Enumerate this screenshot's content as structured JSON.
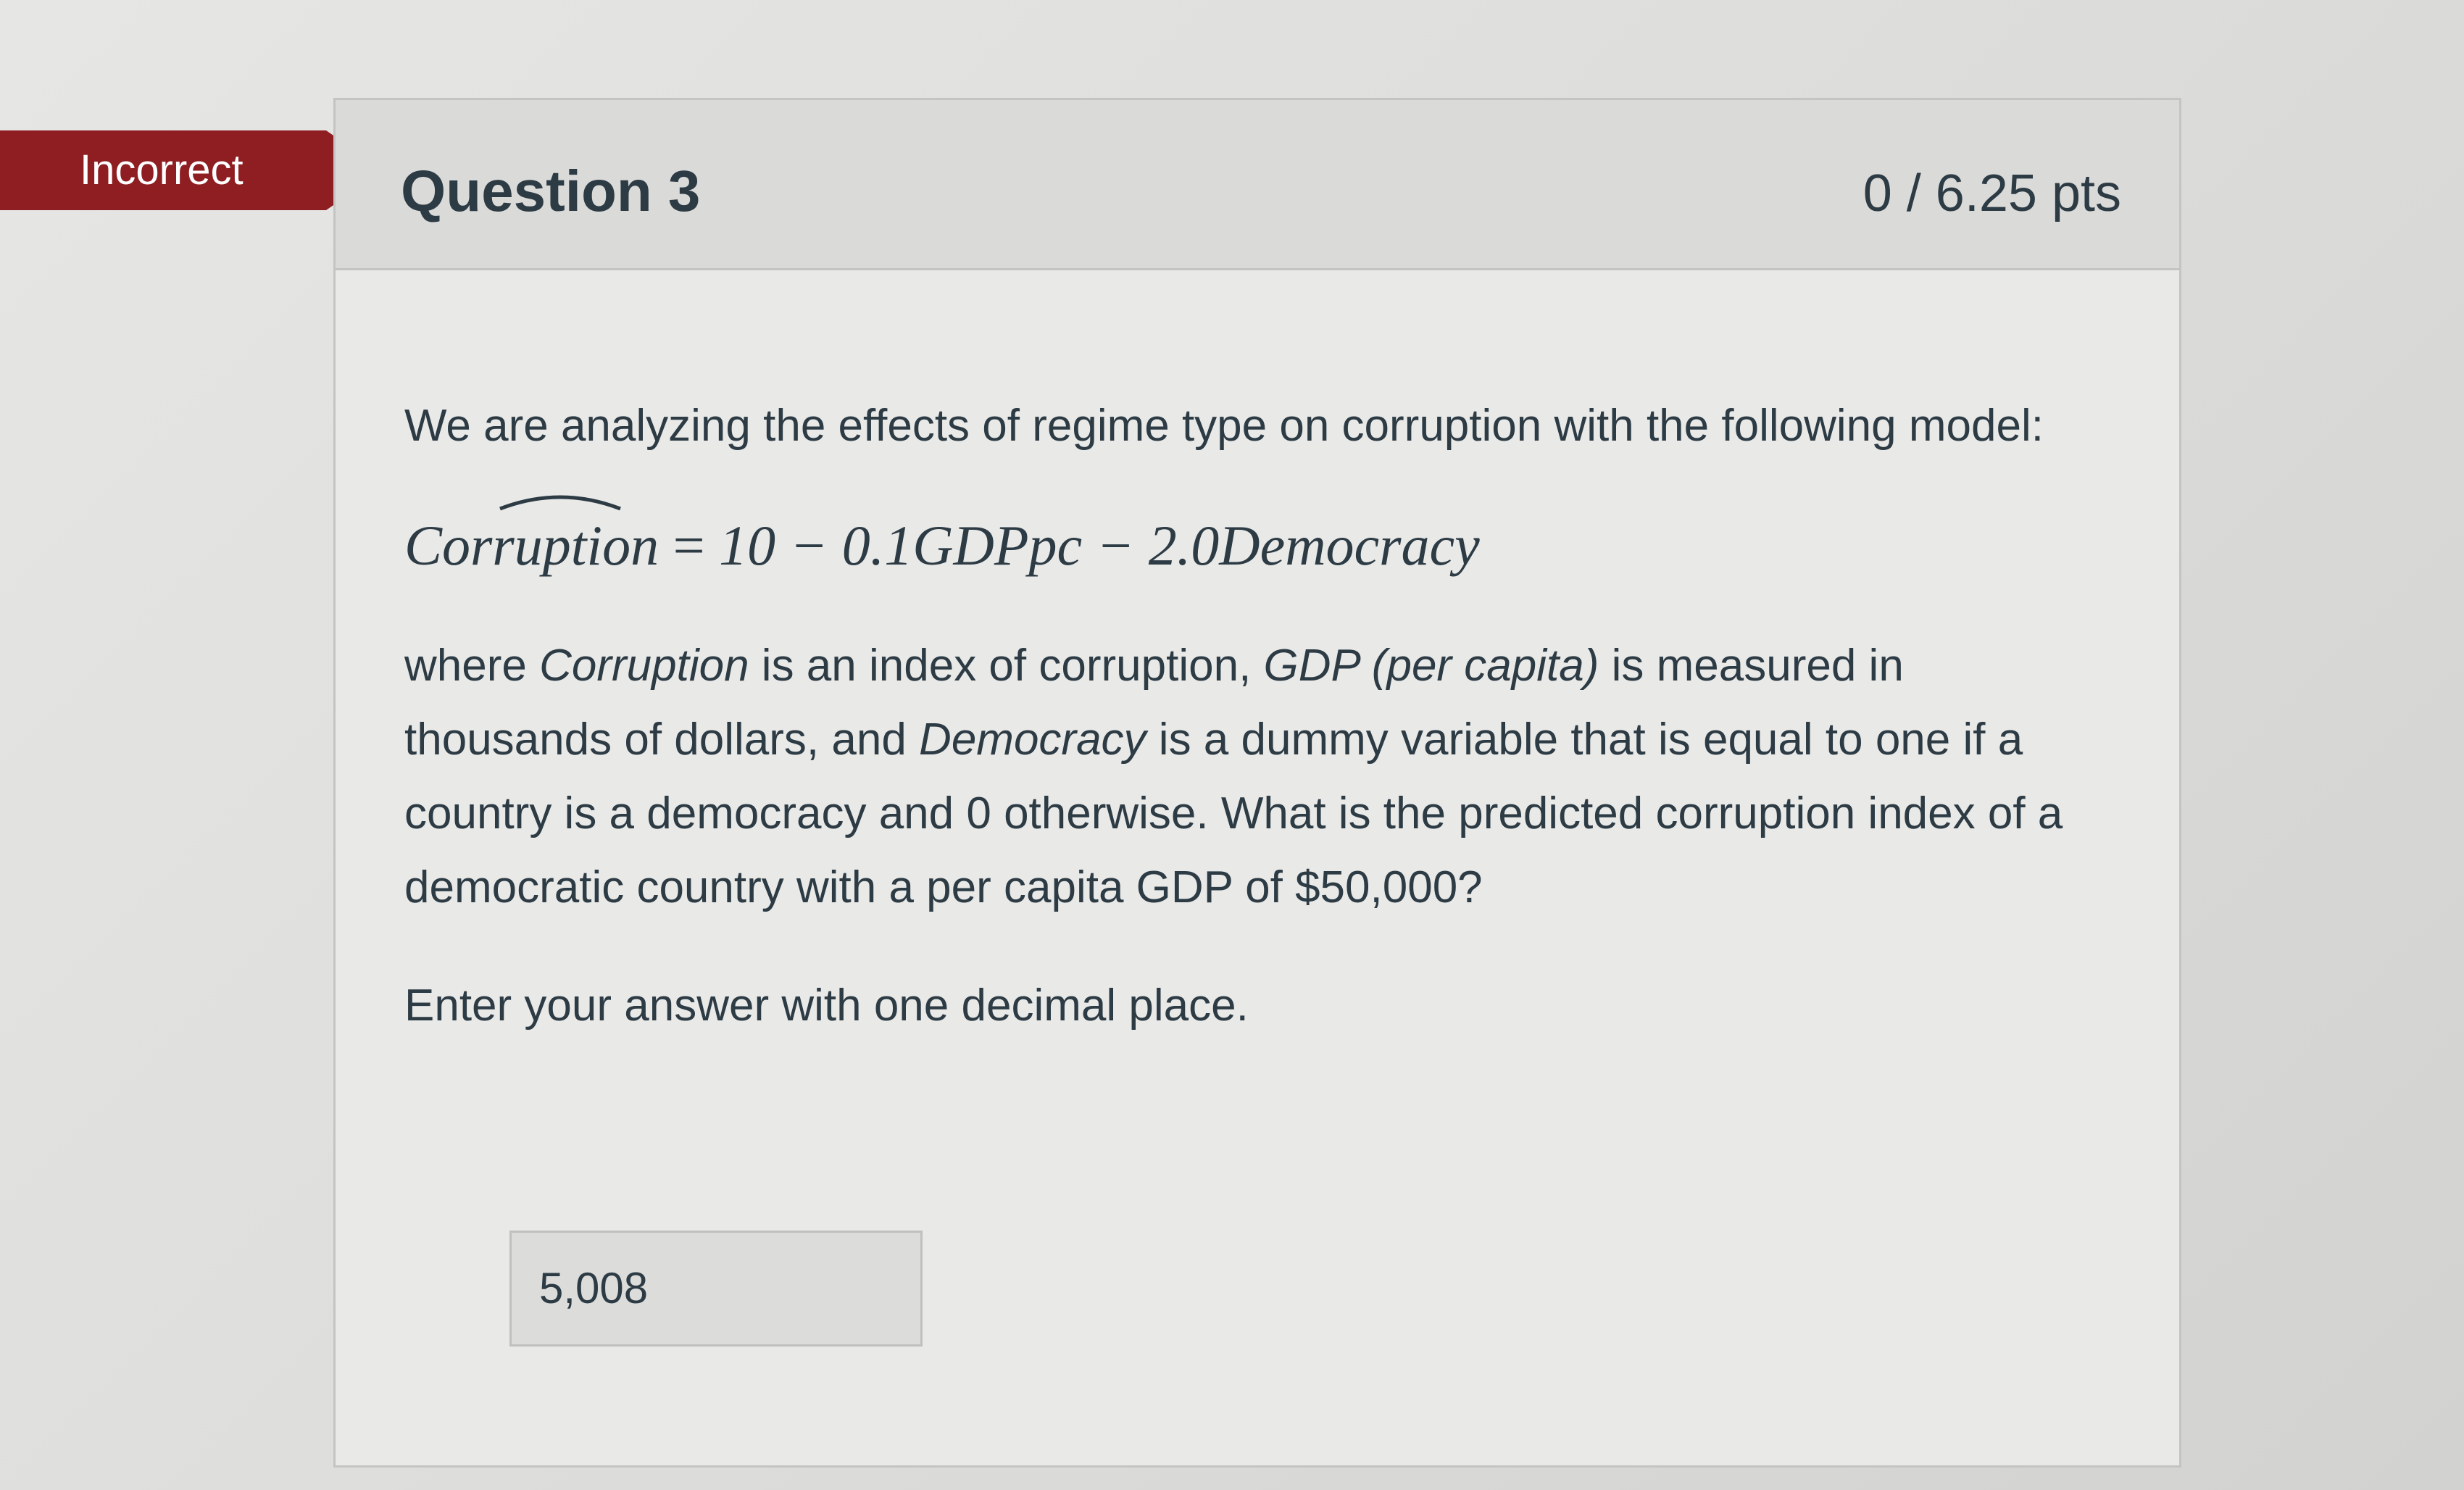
{
  "result": {
    "label": "Incorrect",
    "color": "#8e1e21"
  },
  "question": {
    "title": "Question 3",
    "points": "0 / 6.25 pts",
    "prompt": "We are analyzing the effects of regime type on corruption with the following model:",
    "equation": {
      "lhs": "Corruption",
      "operator": "=",
      "rhs": "10 − 0.1GDPpc − 2.0Democracy"
    },
    "description": {
      "part1": "where ",
      "var1": "Corruption",
      "part2": " is an index of corruption, ",
      "var2": "GDP (per capita)",
      "part3": " is measured in thousands of dollars, and ",
      "var3": "Democracy",
      "part4": " is a dummy variable that is equal to one if a country is a democracy and 0 otherwise. What is the predicted corruption index of a democratic country with a per capita GDP of $50,000?"
    },
    "instruction": "Enter your answer with one decimal place.",
    "answer_value": "5,008"
  }
}
